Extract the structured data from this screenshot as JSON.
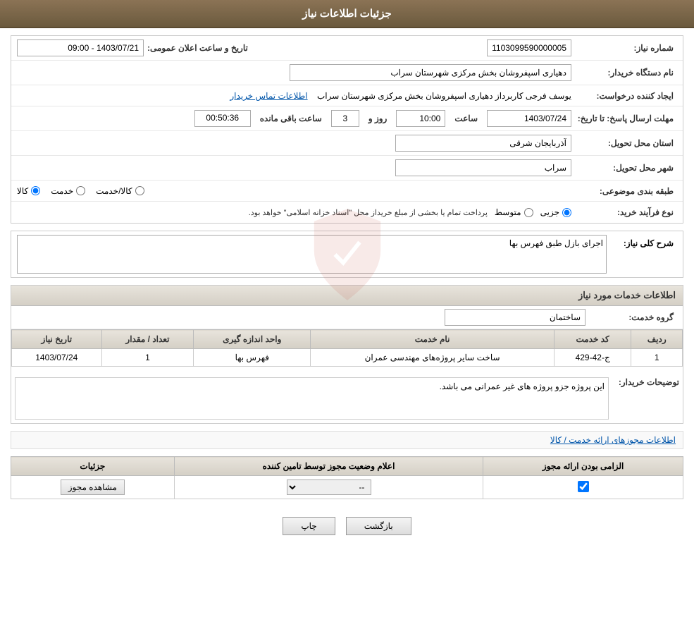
{
  "page": {
    "title": "جزئیات اطلاعات نیاز"
  },
  "header": {
    "title": "جزئیات اطلاعات نیاز"
  },
  "info_section": {
    "need_number_label": "شماره نیاز:",
    "need_number_value": "1103099590000005",
    "buyer_org_label": "نام دستگاه خریدار:",
    "buyer_org_value": "دهیاری اسپفروشان بخش مرکزی شهرستان سراب",
    "creator_label": "ایجاد کننده درخواست:",
    "creator_value": "یوسف فرجی کاربرداز دهیاری اسپفروشان بخش مرکزی شهرستان سراب",
    "contact_link": "اطلاعات تماس خریدار",
    "date_label": "تاریخ و ساعت اعلان عمومی:",
    "date_value": "1403/07/21 - 09:00",
    "response_date_label": "مهلت ارسال پاسخ: تا تاریخ:",
    "response_date": "1403/07/24",
    "response_time_label": "ساعت",
    "response_time": "10:00",
    "response_days_label": "روز و",
    "response_days": "3",
    "countdown_label": "ساعت باقی مانده",
    "countdown_value": "00:50:36",
    "province_label": "استان محل تحویل:",
    "province_value": "آذربایجان شرقی",
    "city_label": "شهر محل تحویل:",
    "city_value": "سراب",
    "category_label": "طبقه بندی موضوعی:",
    "category_options": [
      "کالا",
      "خدمت",
      "کالا/خدمت"
    ],
    "category_selected": "کالا",
    "purchase_type_label": "نوع فرآیند خرید:",
    "purchase_type_options": [
      "جزیی",
      "متوسط"
    ],
    "purchase_type_selected": "جزیی",
    "purchase_type_note": "پرداخت تمام یا بخشی از مبلغ خریداز محل \"اسناد خزانه اسلامی\" خواهد بود."
  },
  "need_description_section": {
    "title": "شرح کلی نیاز:",
    "value": "اجرای بازل طبق فهرس بها"
  },
  "services_section": {
    "title": "اطلاعات خدمات مورد نیاز",
    "service_group_label": "گروه خدمت:",
    "service_group_value": "ساختمان",
    "table_headers": [
      "ردیف",
      "کد خدمت",
      "نام خدمت",
      "واحد اندازه گیری",
      "تعداد / مقدار",
      "تاریخ نیاز"
    ],
    "table_rows": [
      {
        "row": "1",
        "code": "ج-42-429",
        "name": "ساخت سایر پروژه‌های مهندسی عمران",
        "unit": "فهرس بها",
        "quantity": "1",
        "date": "1403/07/24"
      }
    ],
    "buyer_notes_label": "توضیحات خریدار:",
    "buyer_notes_value": "این پروژه جزو پروژه های غیر عمرانی می باشد."
  },
  "permits_section": {
    "link_text": "اطلاعات مجوزهای ارائه خدمت / کالا",
    "table_headers": [
      "الزامی بودن ارائه مجوز",
      "اعلام وضعیت مجوز توسط تامین کننده",
      "جزئیات"
    ],
    "table_rows": [
      {
        "required": true,
        "status": "--",
        "details_btn": "مشاهده مجوز"
      }
    ]
  },
  "footer": {
    "print_btn": "چاپ",
    "back_btn": "بازگشت"
  }
}
